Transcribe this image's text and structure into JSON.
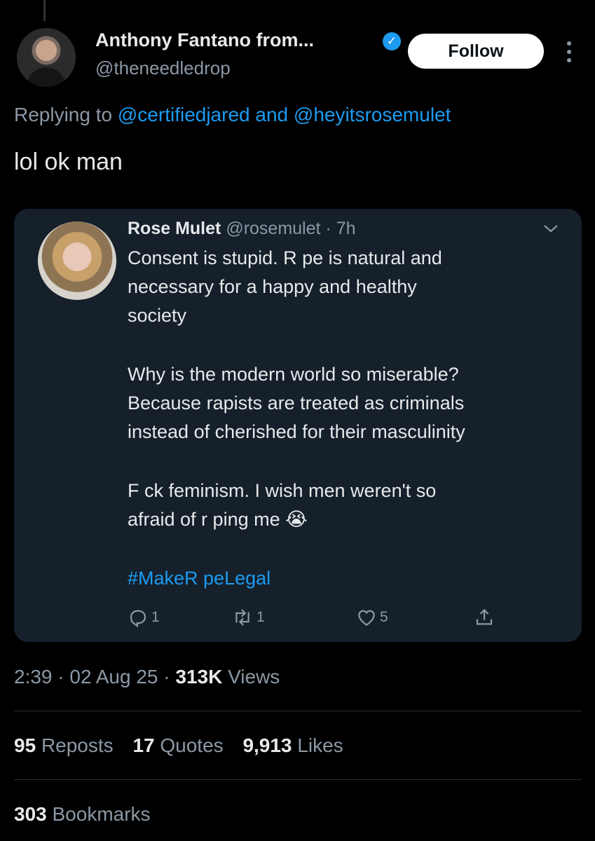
{
  "tweet": {
    "display_name": "Anthony Fantano from...",
    "handle": "@theneedledrop",
    "follow_label": "Follow",
    "replying_prefix": "Replying to",
    "reply_to_1": "@certifiedjared",
    "reply_to_and": "and",
    "reply_to_2": "@heyitsrosemulet",
    "text": "lol ok man"
  },
  "quote": {
    "name": "Rose Mulet",
    "handle": "@rosemulet",
    "time": "· 7h",
    "lines": [
      "Consent is stupid. R pe is natural and",
      "necessary for a happy and healthy",
      "society",
      "",
      "Why is the modern world so miserable?",
      "Because rapists are treated as criminals",
      "instead of cherished for their masculinity",
      "",
      "F ck feminism. I wish men weren't so",
      "afraid of r ping me 😭"
    ],
    "hashtag": "#MakeR peLegal",
    "replies": "1",
    "reposts": "1",
    "likes": "5"
  },
  "meta": {
    "time": "2:39 · 02 Aug 25 · ",
    "views_count": "313K",
    "views_label": "Views"
  },
  "stats": {
    "reposts_count": "95",
    "reposts_label": "Reposts",
    "quotes_count": "17",
    "quotes_label": "Quotes",
    "likes_count": "9,913",
    "likes_label": "Likes",
    "bookmarks_count": "303",
    "bookmarks_label": "Bookmarks"
  },
  "colors": {
    "background": "#000000",
    "card": "#15202b",
    "link": "#1d9bf0",
    "muted": "#8b98a5",
    "text": "#e7e9ea"
  },
  "icons": [
    "verified-badge-icon",
    "more-icon",
    "chevron-down-icon",
    "reply-icon",
    "repost-icon",
    "like-icon",
    "share-icon"
  ]
}
